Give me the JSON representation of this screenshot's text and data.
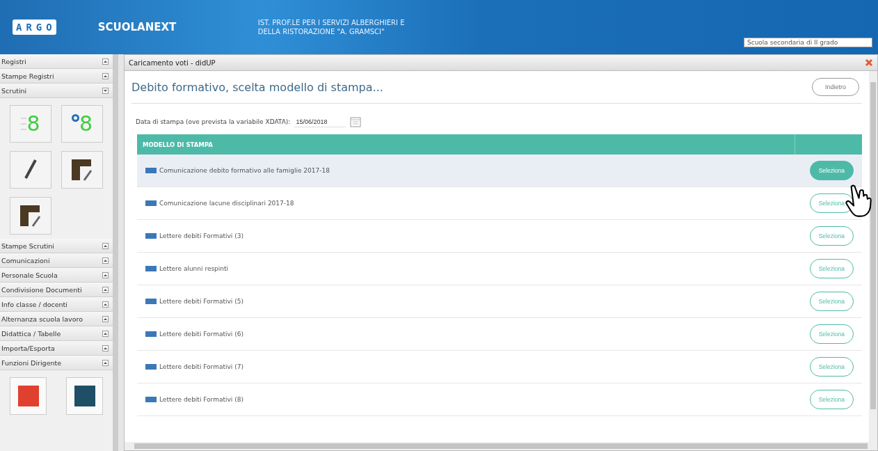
{
  "header": {
    "brand": "ARGO",
    "product": "SCUOLANEXT",
    "school_line_1": "IST. PROF.LE PER I SERVIZI ALBERGHIERI E",
    "school_line_2": "DELLA RISTORAZIONE \"A. GRAMSCI\"",
    "school_type": "Scuola secondaria di II grado"
  },
  "sidebar": {
    "sections": [
      {
        "label": "Registri",
        "expanded": false
      },
      {
        "label": "Stampe Registri",
        "expanded": false
      },
      {
        "label": "Scrutini",
        "expanded": true
      },
      {
        "label": "Stampe Scrutini",
        "expanded": false
      },
      {
        "label": "Comunicazioni",
        "expanded": false
      },
      {
        "label": "Personale Scuola",
        "expanded": false
      },
      {
        "label": "Condivisione Documenti",
        "expanded": false
      },
      {
        "label": "Info classe / docenti",
        "expanded": false
      },
      {
        "label": "Alternanza scuola lavoro",
        "expanded": false
      },
      {
        "label": "Didattica / Tabelle",
        "expanded": false
      },
      {
        "label": "Importa/Esporta",
        "expanded": false
      },
      {
        "label": "Funzioni Dirigente",
        "expanded": false
      }
    ],
    "tiles": [
      {
        "kind": "grade",
        "label": "8"
      },
      {
        "kind": "grade-e",
        "label": "8"
      },
      {
        "kind": "pencil"
      },
      {
        "kind": "board"
      },
      {
        "kind": "board"
      }
    ],
    "bottom_tiles": [
      {
        "color": "#e0402e"
      },
      {
        "color": "#1f4e66"
      }
    ]
  },
  "panel": {
    "title": "Caricamento voti - didUP",
    "heading": "Debito formativo, scelta modello di stampa...",
    "back_button": "Indietro",
    "date_label": "Data di stampa (ove prevista la variabile XDATA):",
    "date_value": "15/06/2018",
    "table": {
      "columns": [
        "MODELLO DI STAMPA"
      ],
      "rows": [
        {
          "name": "Comunicazione debito formativo alle famiglie 2017-18",
          "action": "Seleziona",
          "selected": true
        },
        {
          "name": "Comunicazione lacune disciplinari 2017-18",
          "action": "Seleziona",
          "selected": false
        },
        {
          "name": "Lettere debiti Formativi (3)",
          "action": "Seleziona",
          "selected": false
        },
        {
          "name": "Lettere alunni respinti",
          "action": "Seleziona",
          "selected": false
        },
        {
          "name": "Lettere debiti Formativi (5)",
          "action": "Seleziona",
          "selected": false
        },
        {
          "name": "Lettere debiti Formativi (6)",
          "action": "Seleziona",
          "selected": false
        },
        {
          "name": "Lettere debiti Formativi (7)",
          "action": "Seleziona",
          "selected": false
        },
        {
          "name": "Lettere debiti Formativi (8)",
          "action": "Seleziona",
          "selected": false
        }
      ]
    }
  }
}
